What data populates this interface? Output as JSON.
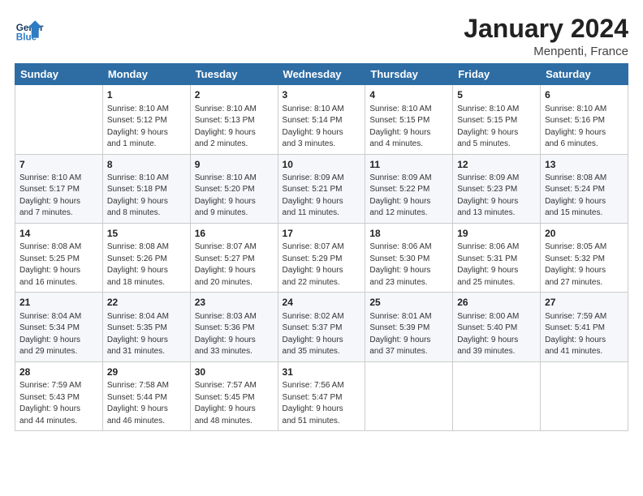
{
  "logo": {
    "line1": "General",
    "line2": "Blue"
  },
  "title": "January 2024",
  "location": "Menpenti, France",
  "days_header": [
    "Sunday",
    "Monday",
    "Tuesday",
    "Wednesday",
    "Thursday",
    "Friday",
    "Saturday"
  ],
  "weeks": [
    [
      {
        "day": "",
        "info": ""
      },
      {
        "day": "1",
        "info": "Sunrise: 8:10 AM\nSunset: 5:12 PM\nDaylight: 9 hours\nand 1 minute."
      },
      {
        "day": "2",
        "info": "Sunrise: 8:10 AM\nSunset: 5:13 PM\nDaylight: 9 hours\nand 2 minutes."
      },
      {
        "day": "3",
        "info": "Sunrise: 8:10 AM\nSunset: 5:14 PM\nDaylight: 9 hours\nand 3 minutes."
      },
      {
        "day": "4",
        "info": "Sunrise: 8:10 AM\nSunset: 5:15 PM\nDaylight: 9 hours\nand 4 minutes."
      },
      {
        "day": "5",
        "info": "Sunrise: 8:10 AM\nSunset: 5:15 PM\nDaylight: 9 hours\nand 5 minutes."
      },
      {
        "day": "6",
        "info": "Sunrise: 8:10 AM\nSunset: 5:16 PM\nDaylight: 9 hours\nand 6 minutes."
      }
    ],
    [
      {
        "day": "7",
        "info": "Sunrise: 8:10 AM\nSunset: 5:17 PM\nDaylight: 9 hours\nand 7 minutes."
      },
      {
        "day": "8",
        "info": "Sunrise: 8:10 AM\nSunset: 5:18 PM\nDaylight: 9 hours\nand 8 minutes."
      },
      {
        "day": "9",
        "info": "Sunrise: 8:10 AM\nSunset: 5:20 PM\nDaylight: 9 hours\nand 9 minutes."
      },
      {
        "day": "10",
        "info": "Sunrise: 8:09 AM\nSunset: 5:21 PM\nDaylight: 9 hours\nand 11 minutes."
      },
      {
        "day": "11",
        "info": "Sunrise: 8:09 AM\nSunset: 5:22 PM\nDaylight: 9 hours\nand 12 minutes."
      },
      {
        "day": "12",
        "info": "Sunrise: 8:09 AM\nSunset: 5:23 PM\nDaylight: 9 hours\nand 13 minutes."
      },
      {
        "day": "13",
        "info": "Sunrise: 8:08 AM\nSunset: 5:24 PM\nDaylight: 9 hours\nand 15 minutes."
      }
    ],
    [
      {
        "day": "14",
        "info": "Sunrise: 8:08 AM\nSunset: 5:25 PM\nDaylight: 9 hours\nand 16 minutes."
      },
      {
        "day": "15",
        "info": "Sunrise: 8:08 AM\nSunset: 5:26 PM\nDaylight: 9 hours\nand 18 minutes."
      },
      {
        "day": "16",
        "info": "Sunrise: 8:07 AM\nSunset: 5:27 PM\nDaylight: 9 hours\nand 20 minutes."
      },
      {
        "day": "17",
        "info": "Sunrise: 8:07 AM\nSunset: 5:29 PM\nDaylight: 9 hours\nand 22 minutes."
      },
      {
        "day": "18",
        "info": "Sunrise: 8:06 AM\nSunset: 5:30 PM\nDaylight: 9 hours\nand 23 minutes."
      },
      {
        "day": "19",
        "info": "Sunrise: 8:06 AM\nSunset: 5:31 PM\nDaylight: 9 hours\nand 25 minutes."
      },
      {
        "day": "20",
        "info": "Sunrise: 8:05 AM\nSunset: 5:32 PM\nDaylight: 9 hours\nand 27 minutes."
      }
    ],
    [
      {
        "day": "21",
        "info": "Sunrise: 8:04 AM\nSunset: 5:34 PM\nDaylight: 9 hours\nand 29 minutes."
      },
      {
        "day": "22",
        "info": "Sunrise: 8:04 AM\nSunset: 5:35 PM\nDaylight: 9 hours\nand 31 minutes."
      },
      {
        "day": "23",
        "info": "Sunrise: 8:03 AM\nSunset: 5:36 PM\nDaylight: 9 hours\nand 33 minutes."
      },
      {
        "day": "24",
        "info": "Sunrise: 8:02 AM\nSunset: 5:37 PM\nDaylight: 9 hours\nand 35 minutes."
      },
      {
        "day": "25",
        "info": "Sunrise: 8:01 AM\nSunset: 5:39 PM\nDaylight: 9 hours\nand 37 minutes."
      },
      {
        "day": "26",
        "info": "Sunrise: 8:00 AM\nSunset: 5:40 PM\nDaylight: 9 hours\nand 39 minutes."
      },
      {
        "day": "27",
        "info": "Sunrise: 7:59 AM\nSunset: 5:41 PM\nDaylight: 9 hours\nand 41 minutes."
      }
    ],
    [
      {
        "day": "28",
        "info": "Sunrise: 7:59 AM\nSunset: 5:43 PM\nDaylight: 9 hours\nand 44 minutes."
      },
      {
        "day": "29",
        "info": "Sunrise: 7:58 AM\nSunset: 5:44 PM\nDaylight: 9 hours\nand 46 minutes."
      },
      {
        "day": "30",
        "info": "Sunrise: 7:57 AM\nSunset: 5:45 PM\nDaylight: 9 hours\nand 48 minutes."
      },
      {
        "day": "31",
        "info": "Sunrise: 7:56 AM\nSunset: 5:47 PM\nDaylight: 9 hours\nand 51 minutes."
      },
      {
        "day": "",
        "info": ""
      },
      {
        "day": "",
        "info": ""
      },
      {
        "day": "",
        "info": ""
      }
    ]
  ]
}
